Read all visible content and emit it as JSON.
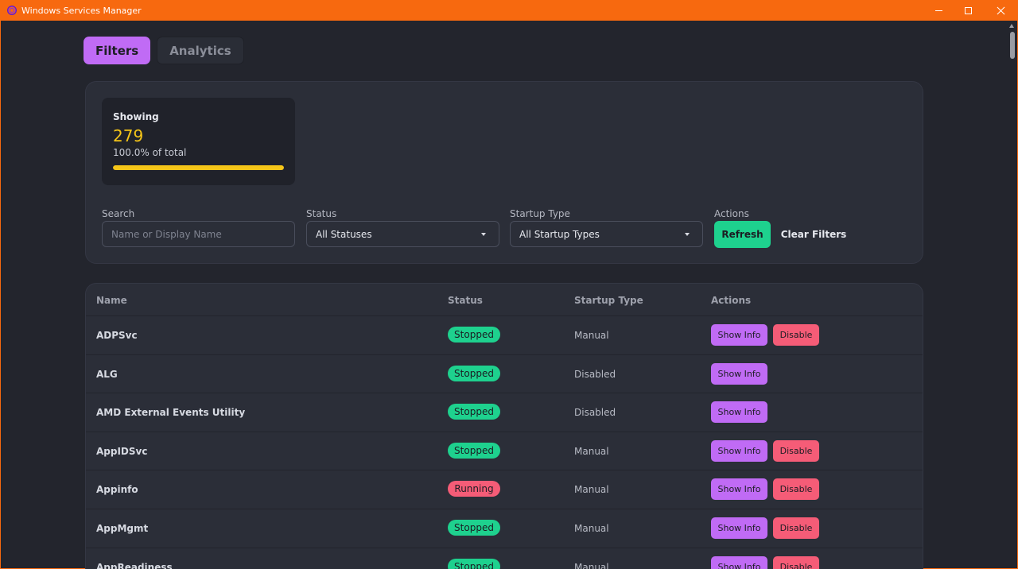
{
  "window": {
    "title": "Windows Services Manager",
    "accent_color": "#f7690f"
  },
  "tabs": [
    {
      "label": "Filters",
      "active": true
    },
    {
      "label": "Analytics",
      "active": false
    }
  ],
  "stats": {
    "label": "Showing",
    "count": "279",
    "percent_text": "100.0% of total",
    "percent_value": 1.0
  },
  "filters": {
    "search_label": "Search",
    "search_placeholder": "Name or Display Name",
    "status_label": "Status",
    "status_value": "All Statuses",
    "startup_label": "Startup Type",
    "startup_value": "All Startup Types",
    "actions_label": "Actions",
    "refresh_label": "Refresh",
    "clear_label": "Clear Filters"
  },
  "table": {
    "headers": {
      "name": "Name",
      "status": "Status",
      "startup": "Startup Type",
      "actions": "Actions"
    },
    "info_label": "Show Info",
    "disable_label": "Disable",
    "rows": [
      {
        "name": "ADPSvc",
        "status": "Stopped",
        "startup": "Manual",
        "can_disable": true
      },
      {
        "name": "ALG",
        "status": "Stopped",
        "startup": "Disabled",
        "can_disable": false
      },
      {
        "name": "AMD External Events Utility",
        "status": "Stopped",
        "startup": "Disabled",
        "can_disable": false
      },
      {
        "name": "AppIDSvc",
        "status": "Stopped",
        "startup": "Manual",
        "can_disable": true
      },
      {
        "name": "Appinfo",
        "status": "Running",
        "startup": "Manual",
        "can_disable": true
      },
      {
        "name": "AppMgmt",
        "status": "Stopped",
        "startup": "Manual",
        "can_disable": true
      },
      {
        "name": "AppReadiness",
        "status": "Stopped",
        "startup": "Manual",
        "can_disable": true
      }
    ]
  }
}
